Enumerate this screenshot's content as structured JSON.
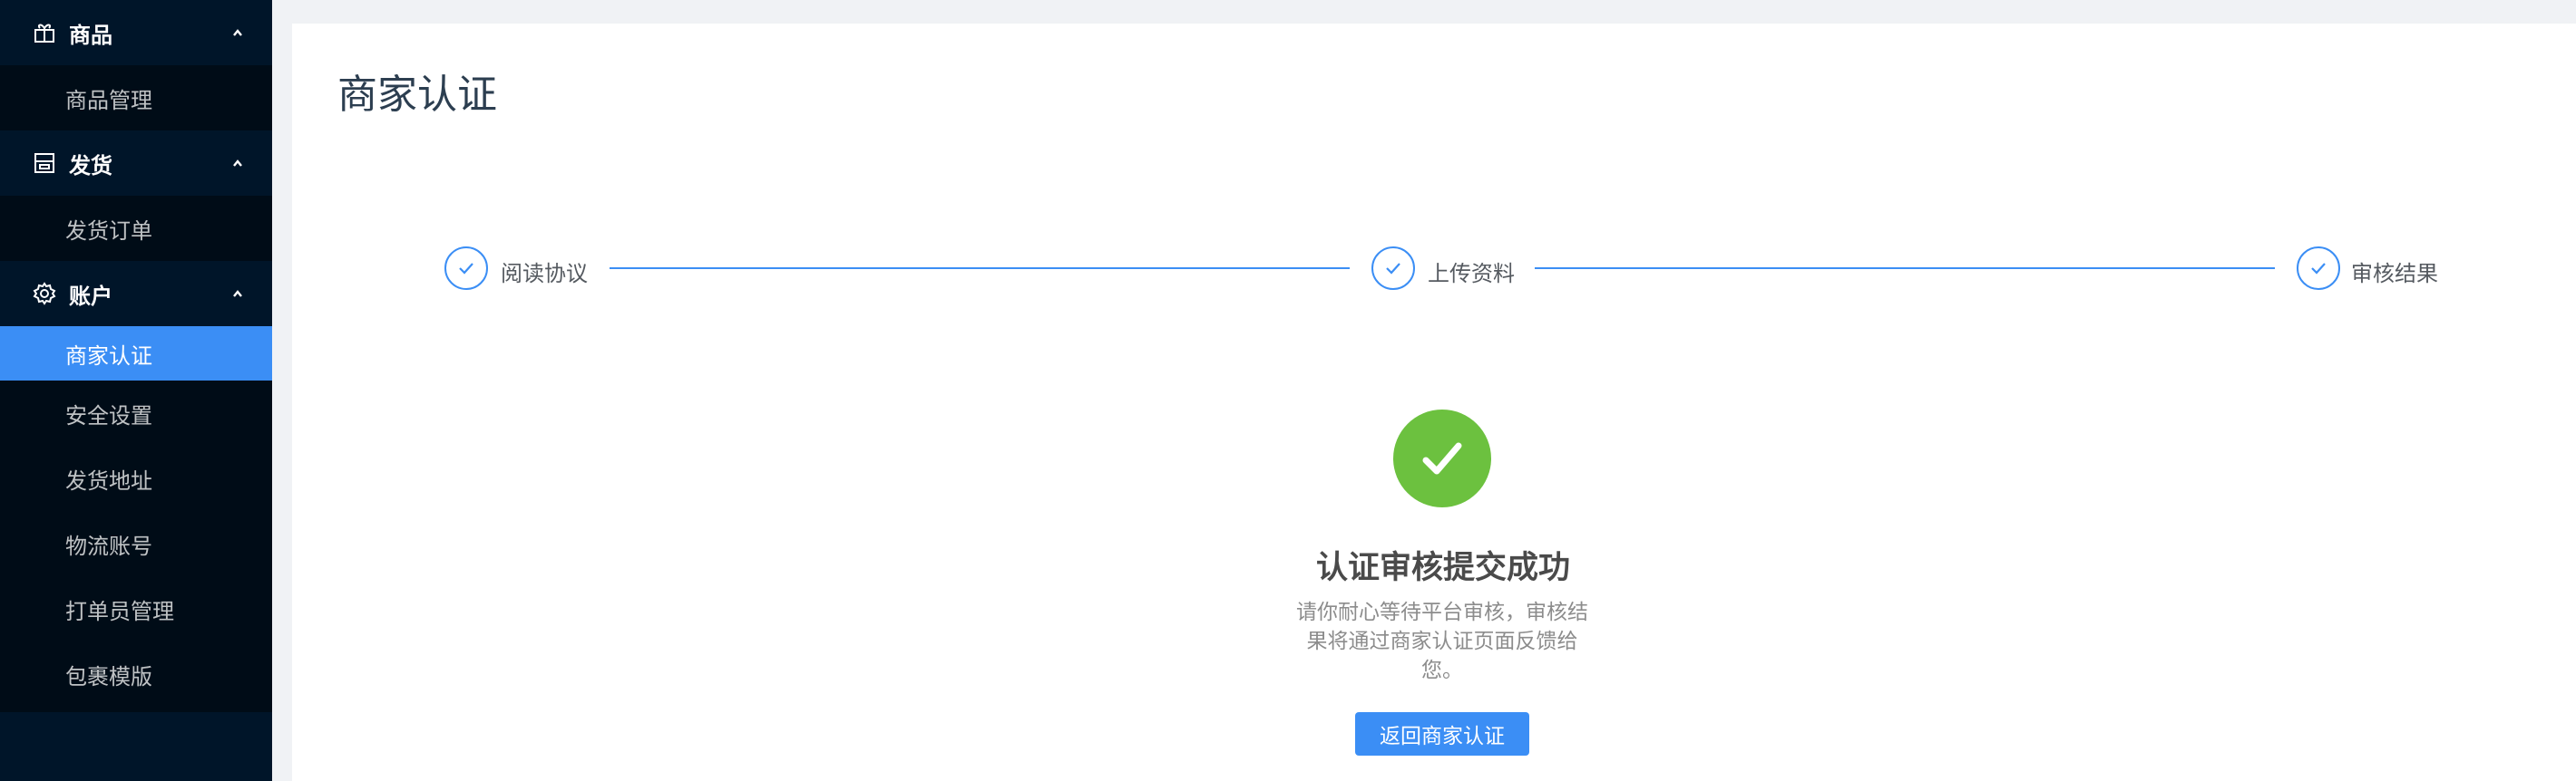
{
  "sidebar": {
    "groups": [
      {
        "label": "商品",
        "icon": "gift-icon",
        "items": [
          "商品管理"
        ]
      },
      {
        "label": "发货",
        "icon": "printer-icon",
        "items": [
          "发货订单"
        ]
      },
      {
        "label": "账户",
        "icon": "gear-icon",
        "items": [
          "商家认证",
          "安全设置",
          "发货地址",
          "物流账号",
          "打单员管理",
          "包裹模版"
        ]
      }
    ],
    "active_item": "商家认证"
  },
  "main": {
    "title": "商家认证",
    "steps": [
      {
        "label": "阅读协议",
        "status": "done"
      },
      {
        "label": "上传资料",
        "status": "done"
      },
      {
        "label": "审核结果",
        "status": "done"
      }
    ],
    "result": {
      "icon": "check-circle-icon",
      "title": "认证审核提交成功",
      "description": "请你耐心等待平台审核，审核结果将通过商家认证页面反馈给您。",
      "button_label": "返回商家认证"
    }
  },
  "colors": {
    "sidebar_bg": "#001529",
    "submenu_bg": "#000c17",
    "accent": "#3b8ef5",
    "success": "#6cc13f"
  }
}
